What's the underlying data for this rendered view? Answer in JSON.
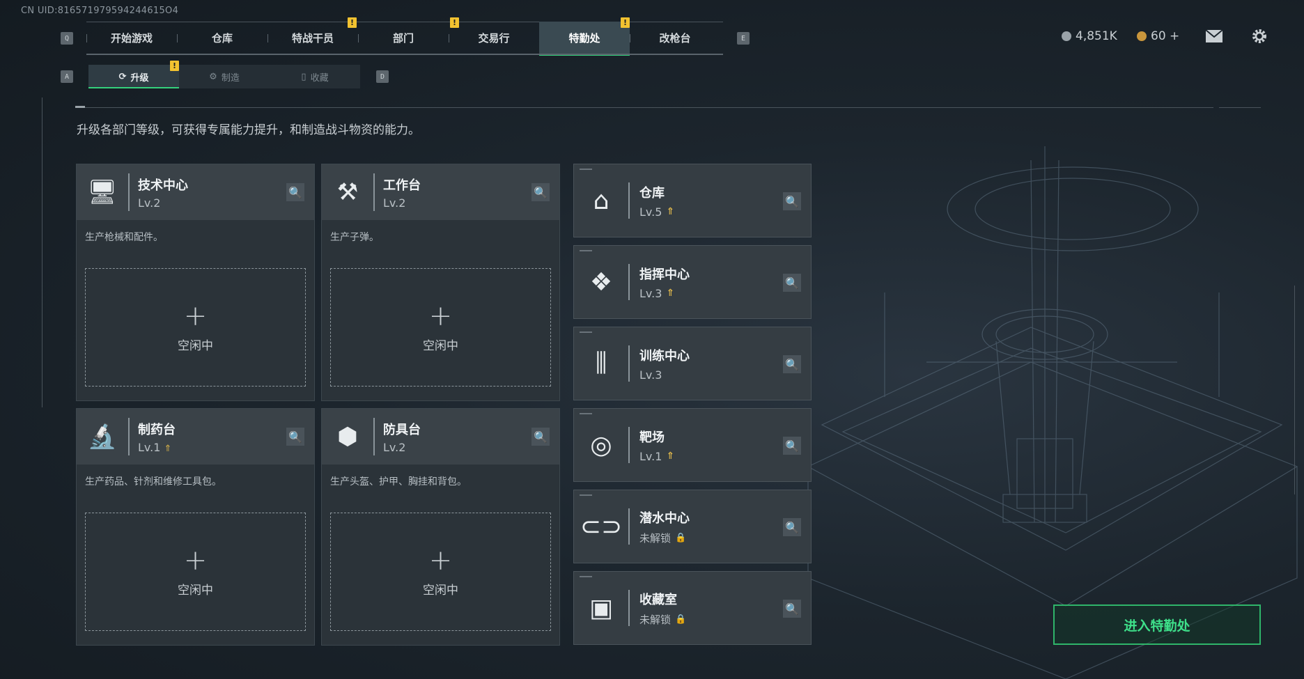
{
  "uid": "CN UID:816571979594244615O4",
  "nav": {
    "key_left": "Q",
    "key_right": "E",
    "tabs": [
      {
        "label": "开始游戏",
        "badge": ""
      },
      {
        "label": "仓库",
        "badge": ""
      },
      {
        "label": "特战干员",
        "badge": "!"
      },
      {
        "label": "部门",
        "badge": ""
      },
      {
        "label": "交易行",
        "badge": "!"
      },
      {
        "label": "特勤处",
        "badge": "!"
      },
      {
        "label": "改枪台",
        "badge": ""
      }
    ]
  },
  "resources": {
    "money": "4,851K",
    "coins": "60 +",
    "money_color": "#9aa3a9",
    "coin_color": "#c9963c"
  },
  "subnav": {
    "key_left": "A",
    "key_right": "D",
    "tabs": [
      {
        "label": "升级",
        "icon": "upgrade-icon",
        "badge": "!"
      },
      {
        "label": "制造",
        "icon": "craft-icon",
        "badge": ""
      },
      {
        "label": "收藏",
        "icon": "collection-icon",
        "badge": ""
      }
    ]
  },
  "description": "升级各部门等级，可获得专属能力提升，和制造战斗物资的能力。",
  "workbenches": [
    {
      "name": "技术中心",
      "level": "Lv.2",
      "desc": "生产枪械和配件。",
      "icon": "computer-icon",
      "slot_status": "空闲中"
    },
    {
      "name": "工作台",
      "level": "Lv.2",
      "desc": "生产子弹。",
      "icon": "tools-icon",
      "slot_status": "空闲中"
    },
    {
      "name": "制药台",
      "level": "Lv.1",
      "desc": "生产药品、针剂和维修工具包。",
      "icon": "microscope-icon",
      "slot_status": "空闲中"
    },
    {
      "name": "防具台",
      "level": "Lv.2",
      "desc": "生产头盔、护甲、胸挂和背包。",
      "icon": "cubes-icon",
      "slot_status": "空闲中"
    }
  ],
  "departments": [
    {
      "name": "仓库",
      "level": "Lv.5",
      "upgradable": true,
      "locked": false,
      "icon": "warehouse-icon"
    },
    {
      "name": "指挥中心",
      "level": "Lv.3",
      "upgradable": true,
      "locked": false,
      "icon": "command-icon"
    },
    {
      "name": "训练中心",
      "level": "Lv.3",
      "upgradable": false,
      "locked": false,
      "icon": "dumbbell-icon"
    },
    {
      "name": "靶场",
      "level": "Lv.1",
      "upgradable": true,
      "locked": false,
      "icon": "target-icon"
    },
    {
      "name": "潜水中心",
      "level": "未解锁",
      "upgradable": false,
      "locked": true,
      "icon": "diving-mask-icon"
    },
    {
      "name": "收藏室",
      "level": "未解锁",
      "upgradable": false,
      "locked": true,
      "icon": "trophy-case-icon"
    }
  ],
  "enter_button": "进入特勤处",
  "accent_color": "#34d17c"
}
